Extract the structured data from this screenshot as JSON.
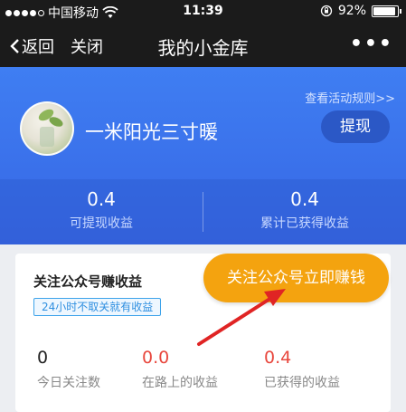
{
  "status_bar": {
    "carrier": "中国移动",
    "time": "11:39",
    "battery_percent": "92%",
    "battery_level": 0.92,
    "icons": [
      "signal-dots",
      "wifi-icon",
      "rotation-lock-icon",
      "battery-icon"
    ]
  },
  "nav": {
    "back_label": "返回",
    "close_label": "关闭",
    "title": "我的小金库",
    "more_label": "•••"
  },
  "profile": {
    "rules_link": "查看活动规则>>",
    "username": "一米阳光三寸暖",
    "withdraw_label": "提现"
  },
  "stats": {
    "withdrawable": {
      "value": "0.4",
      "label": "可提现收益"
    },
    "earned_total": {
      "value": "0.4",
      "label": "累计已获得收益"
    }
  },
  "card": {
    "title": "关注公众号赚收益",
    "tag": "24小时不取关就有收益",
    "follow_button": "关注公众号立即赚钱",
    "stats": [
      {
        "value": "0",
        "label": "今日关注数",
        "color": "#222222"
      },
      {
        "value": "0.0",
        "label": "在路上的收益",
        "color": "#e8473d"
      },
      {
        "value": "0.4",
        "label": "已获得的收益",
        "color": "#e8473d"
      }
    ]
  },
  "colors": {
    "hero_blue": "#3f7ef2",
    "button_orange": "#f4a30f",
    "accent_red": "#e8473d",
    "arrow_red": "#e02424"
  }
}
